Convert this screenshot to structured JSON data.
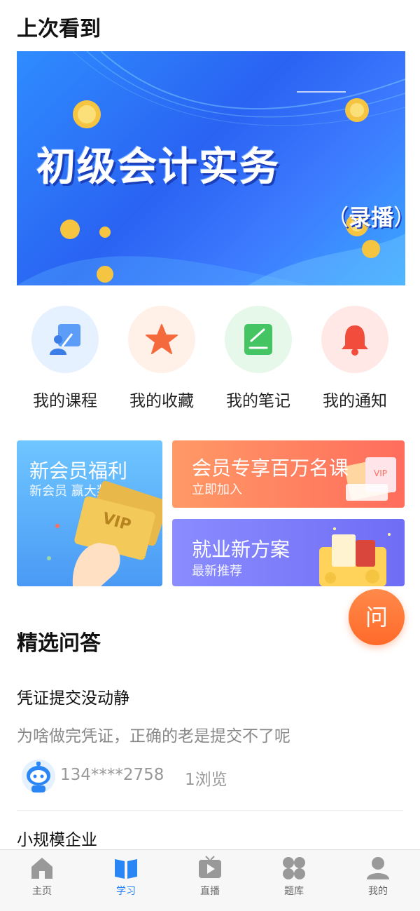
{
  "recent": {
    "title": "上次看到"
  },
  "banner": {
    "title": "初级会计实务",
    "tag_open": "（",
    "tag": "录播",
    "tag_close": "）"
  },
  "shortcuts": [
    {
      "label": "我的课程",
      "icon": "course-board-icon",
      "bg": "#e6f1ff",
      "color": "#4a8ff5"
    },
    {
      "label": "我的收藏",
      "icon": "star-icon",
      "bg": "#fff0e8",
      "color": "#f46a3c"
    },
    {
      "label": "我的笔记",
      "icon": "note-icon",
      "bg": "#e6f8ea",
      "color": "#44c463"
    },
    {
      "label": "我的通知",
      "icon": "bell-icon",
      "bg": "#ffe8e6",
      "color": "#f24c3d"
    }
  ],
  "promos": {
    "new_member": {
      "title": "新会员福利",
      "sub": "新会员 赢大奖",
      "badge": "VIP"
    },
    "vip_courses": {
      "title": "会员专享百万名课",
      "sub": "立即加入",
      "badge": "VIP"
    },
    "job": {
      "title": "就业新方案",
      "sub": "最新推荐"
    }
  },
  "fab": {
    "label": "问"
  },
  "qa": {
    "title": "精选问答",
    "items": [
      {
        "title": "凭证提交没动静",
        "body": "为啥做完凭证，正确的老是提交不了呢",
        "user": "134****2758",
        "views": "1浏览"
      },
      {
        "title": "小规模企业"
      }
    ]
  },
  "tabs": [
    {
      "label": "主页",
      "icon": "home-icon"
    },
    {
      "label": "学习",
      "icon": "book-icon",
      "active": true
    },
    {
      "label": "直播",
      "icon": "tv-play-icon"
    },
    {
      "label": "题库",
      "icon": "grid-four-icon"
    },
    {
      "label": "我的",
      "icon": "user-icon"
    }
  ],
  "colors": {
    "accent": "#2a86f5",
    "fab": "#ff6a2a",
    "muted_text": "#888888"
  }
}
